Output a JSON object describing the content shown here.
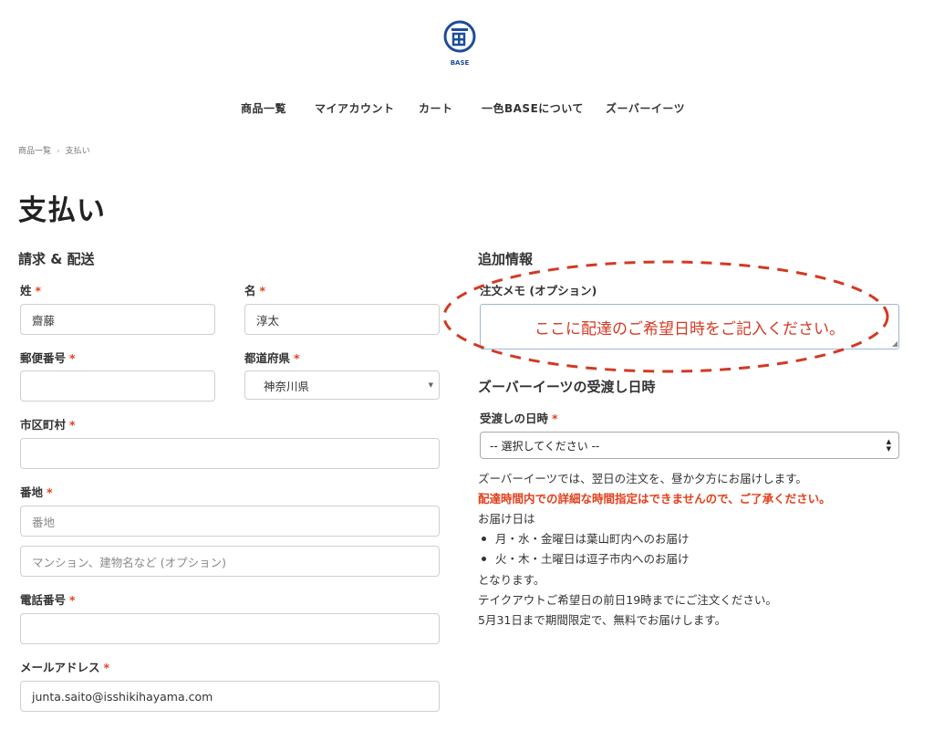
{
  "logo": {
    "text": "BASE"
  },
  "nav": [
    "商品一覧",
    "マイアカウント",
    "カート",
    "一色BASEについて",
    "ズーバーイーツ"
  ],
  "breadcrumb": {
    "home": "商品一覧",
    "separator": "›",
    "current": "支払い"
  },
  "page_title": "支払い",
  "billing": {
    "heading": "請求 & 配送",
    "required_mark": "*",
    "last_name": {
      "label": "姓",
      "value": "齋藤"
    },
    "first_name": {
      "label": "名",
      "value": "淳太"
    },
    "postcode": {
      "label": "郵便番号",
      "value": ""
    },
    "prefecture": {
      "label": "都道府県",
      "value": "神奈川県"
    },
    "city": {
      "label": "市区町村",
      "value": ""
    },
    "address": {
      "label": "番地",
      "placeholder": "番地",
      "placeholder2": "マンション、建物名など (オプション)"
    },
    "phone": {
      "label": "電話番号",
      "value": ""
    },
    "email": {
      "label": "メールアドレス",
      "value": "junta.saito@isshikihayama.com"
    }
  },
  "additional": {
    "heading": "追加情報",
    "note_label": "注文メモ (オプション)",
    "note_placeholder": "ここに配達のご希望日時をご記入ください。",
    "annotation_color": "#d23a23"
  },
  "delivery": {
    "heading": "ズーバーイーツの受渡し日時",
    "label": "受渡しの日時",
    "select_value": "-- 選択してください --",
    "info": {
      "line1": "ズーバーイーツでは、翌日の注文を、昼か夕方にお届けします。",
      "warning": "配達時間内での詳細な時間指定はできませんので、ご了承ください。",
      "line3": "お届け日は",
      "bullets": [
        "月・水・金曜日は葉山町内へのお届け",
        "火・木・土曜日は逗子市内へのお届け"
      ],
      "line4": "となります。",
      "line5": "テイクアウトご希望日の前日19時までにご注文ください。",
      "line6": "5月31日まで期間限定で、無料でお届けします。"
    }
  },
  "colors": {
    "required": "#e2401c",
    "logo_blue": "#1e4c9a"
  }
}
